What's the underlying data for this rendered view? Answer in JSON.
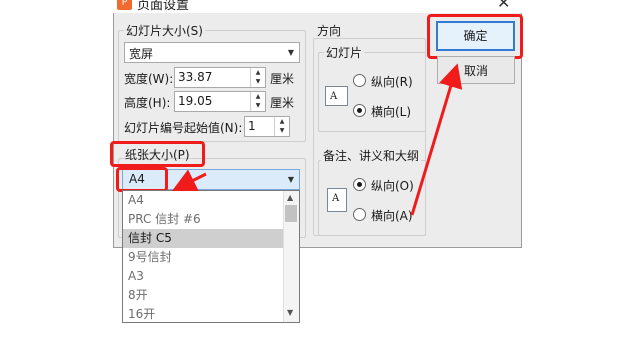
{
  "window": {
    "title": "页面设置",
    "app_icon": "wps-presentation-icon",
    "close_glyph": "✕"
  },
  "slide_size": {
    "group_label": "幻灯片大小(S)",
    "selected": "宽屏",
    "width_label": "宽度(W):",
    "width_value": "33.87",
    "width_unit": "厘米",
    "height_label": "高度(H):",
    "height_value": "19.05",
    "height_unit": "厘米",
    "start_number_label": "幻灯片编号起始值(N):",
    "start_number_value": "1"
  },
  "paper_size": {
    "group_label": "纸张大小(P)",
    "selected": "A4",
    "options": [
      "A4",
      "PRC 信封 #6",
      "信封 C5",
      "9号信封",
      "A3",
      "8开",
      "16开"
    ],
    "highlighted_index": 2
  },
  "orientation": {
    "group_label": "方向",
    "slides_label": "幻灯片",
    "slides_options": [
      {
        "label": "纵向(R)",
        "checked": false
      },
      {
        "label": "横向(L)",
        "checked": true
      }
    ],
    "notes_label": "备注、讲义和大纲",
    "notes_options": [
      {
        "label": "纵向(O)",
        "checked": true
      },
      {
        "label": "横向(A)",
        "checked": false
      }
    ],
    "page_icon_letter": "A"
  },
  "buttons": {
    "ok": "确定",
    "cancel": "取消"
  },
  "colors": {
    "highlight_red": "#f01c1c",
    "accent_blue": "#2f7bd6",
    "app_orange": "#f26a2e"
  }
}
